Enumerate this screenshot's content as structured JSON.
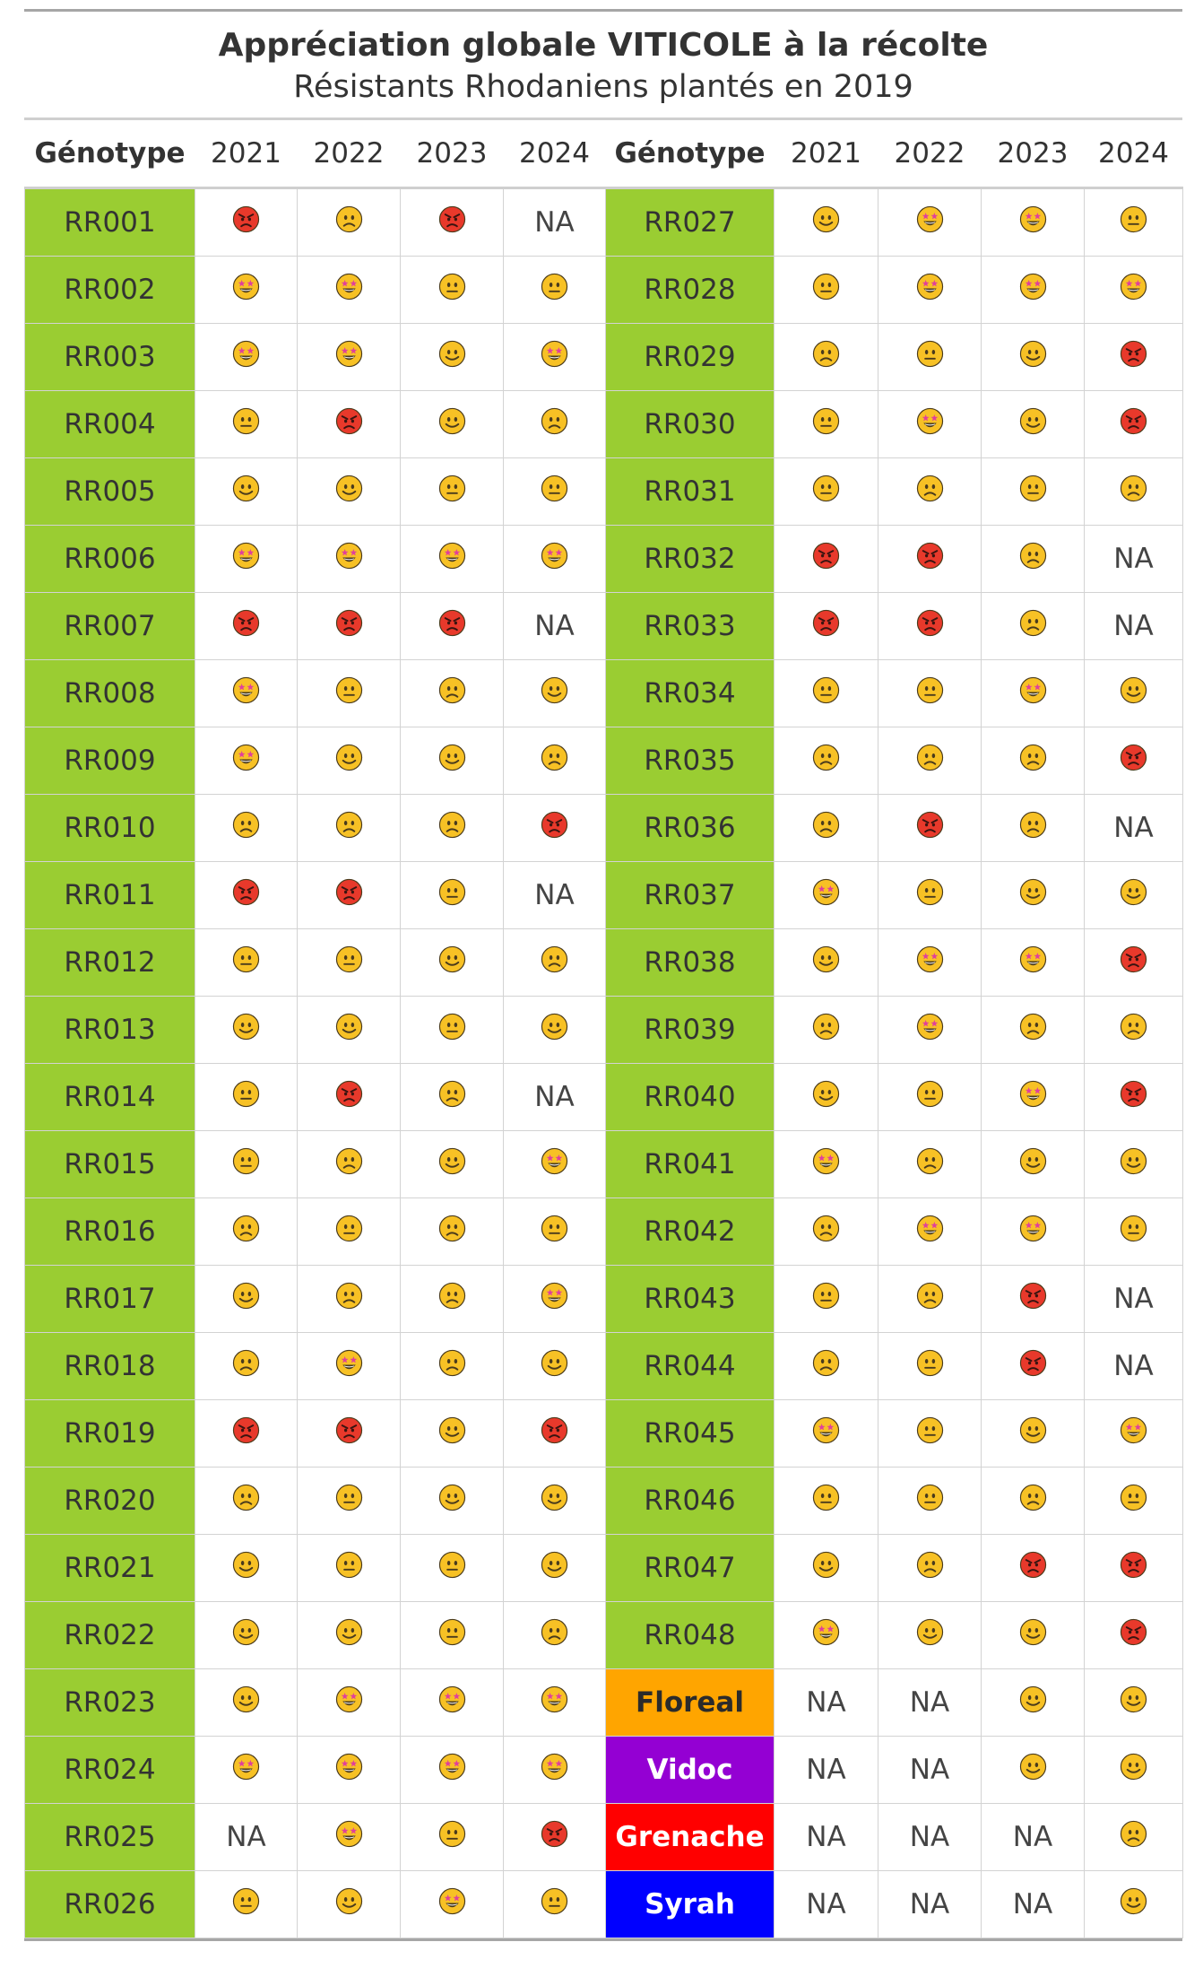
{
  "title": "Appréciation globale VITICOLE à la récolte",
  "subtitle": "Résistants Rhodaniens plantés en 2019",
  "headers": [
    "Génotype",
    "2021",
    "2022",
    "2023",
    "2024"
  ],
  "na_text": "NA",
  "colors": {
    "rr": "#9acd32",
    "Floreal": "#ffa500",
    "Vidoc": "#9400d3",
    "Grenache": "#ff0000",
    "Syrah": "#0000ff",
    "emoji_yellow": "#f7c125",
    "emoji_red": "#e8392b",
    "emoji_stars": "#e0409b"
  },
  "scale": {
    "angry": "very bad",
    "frown": "bad",
    "neutral": "average",
    "smile": "good",
    "stars": "very good"
  },
  "rows": [
    {
      "name": "RR001",
      "v": [
        "angry",
        "frown",
        "angry",
        "NA"
      ]
    },
    {
      "name": "RR002",
      "v": [
        "stars",
        "stars",
        "neutral",
        "neutral"
      ]
    },
    {
      "name": "RR003",
      "v": [
        "stars",
        "stars",
        "smile",
        "stars"
      ]
    },
    {
      "name": "RR004",
      "v": [
        "neutral",
        "angry",
        "smile",
        "frown"
      ]
    },
    {
      "name": "RR005",
      "v": [
        "smile",
        "smile",
        "neutral",
        "neutral"
      ]
    },
    {
      "name": "RR006",
      "v": [
        "stars",
        "stars",
        "stars",
        "stars"
      ]
    },
    {
      "name": "RR007",
      "v": [
        "angry",
        "angry",
        "angry",
        "NA"
      ]
    },
    {
      "name": "RR008",
      "v": [
        "stars",
        "neutral",
        "frown",
        "smile"
      ]
    },
    {
      "name": "RR009",
      "v": [
        "stars",
        "smile",
        "smile",
        "frown"
      ]
    },
    {
      "name": "RR010",
      "v": [
        "frown",
        "frown",
        "frown",
        "angry"
      ]
    },
    {
      "name": "RR011",
      "v": [
        "angry",
        "angry",
        "neutral",
        "NA"
      ]
    },
    {
      "name": "RR012",
      "v": [
        "neutral",
        "neutral",
        "smile",
        "frown"
      ]
    },
    {
      "name": "RR013",
      "v": [
        "smile",
        "smile",
        "neutral",
        "smile"
      ]
    },
    {
      "name": "RR014",
      "v": [
        "neutral",
        "angry",
        "frown",
        "NA"
      ]
    },
    {
      "name": "RR015",
      "v": [
        "neutral",
        "frown",
        "smile",
        "stars"
      ]
    },
    {
      "name": "RR016",
      "v": [
        "frown",
        "neutral",
        "frown",
        "neutral"
      ]
    },
    {
      "name": "RR017",
      "v": [
        "smile",
        "frown",
        "frown",
        "stars"
      ]
    },
    {
      "name": "RR018",
      "v": [
        "frown",
        "stars",
        "frown",
        "smile"
      ]
    },
    {
      "name": "RR019",
      "v": [
        "angry",
        "angry",
        "smile",
        "angry"
      ]
    },
    {
      "name": "RR020",
      "v": [
        "frown",
        "neutral",
        "smile",
        "smile"
      ]
    },
    {
      "name": "RR021",
      "v": [
        "smile",
        "neutral",
        "neutral",
        "smile"
      ]
    },
    {
      "name": "RR022",
      "v": [
        "smile",
        "smile",
        "neutral",
        "frown"
      ]
    },
    {
      "name": "RR023",
      "v": [
        "smile",
        "stars",
        "stars",
        "stars"
      ]
    },
    {
      "name": "RR024",
      "v": [
        "stars",
        "stars",
        "stars",
        "stars"
      ]
    },
    {
      "name": "RR025",
      "v": [
        "NA",
        "stars",
        "neutral",
        "angry"
      ]
    },
    {
      "name": "RR026",
      "v": [
        "neutral",
        "smile",
        "stars",
        "neutral"
      ]
    },
    {
      "name": "RR027",
      "v": [
        "smile",
        "stars",
        "stars",
        "neutral"
      ]
    },
    {
      "name": "RR028",
      "v": [
        "neutral",
        "stars",
        "stars",
        "stars"
      ]
    },
    {
      "name": "RR029",
      "v": [
        "frown",
        "neutral",
        "smile",
        "angry"
      ]
    },
    {
      "name": "RR030",
      "v": [
        "neutral",
        "stars",
        "smile",
        "angry"
      ]
    },
    {
      "name": "RR031",
      "v": [
        "neutral",
        "frown",
        "neutral",
        "frown"
      ]
    },
    {
      "name": "RR032",
      "v": [
        "angry",
        "angry",
        "frown",
        "NA"
      ]
    },
    {
      "name": "RR033",
      "v": [
        "angry",
        "angry",
        "frown",
        "NA"
      ]
    },
    {
      "name": "RR034",
      "v": [
        "neutral",
        "neutral",
        "stars",
        "smile"
      ]
    },
    {
      "name": "RR035",
      "v": [
        "frown",
        "frown",
        "frown",
        "angry"
      ]
    },
    {
      "name": "RR036",
      "v": [
        "frown",
        "angry",
        "frown",
        "NA"
      ]
    },
    {
      "name": "RR037",
      "v": [
        "stars",
        "neutral",
        "smile",
        "smile"
      ]
    },
    {
      "name": "RR038",
      "v": [
        "smile",
        "stars",
        "stars",
        "angry"
      ]
    },
    {
      "name": "RR039",
      "v": [
        "frown",
        "stars",
        "frown",
        "frown"
      ]
    },
    {
      "name": "RR040",
      "v": [
        "smile",
        "neutral",
        "stars",
        "angry"
      ]
    },
    {
      "name": "RR041",
      "v": [
        "stars",
        "frown",
        "smile",
        "smile"
      ]
    },
    {
      "name": "RR042",
      "v": [
        "frown",
        "stars",
        "stars",
        "neutral"
      ]
    },
    {
      "name": "RR043",
      "v": [
        "neutral",
        "frown",
        "angry",
        "NA"
      ]
    },
    {
      "name": "RR044",
      "v": [
        "frown",
        "neutral",
        "angry",
        "NA"
      ]
    },
    {
      "name": "RR045",
      "v": [
        "stars",
        "neutral",
        "smile",
        "stars"
      ]
    },
    {
      "name": "RR046",
      "v": [
        "neutral",
        "neutral",
        "frown",
        "neutral"
      ]
    },
    {
      "name": "RR047",
      "v": [
        "smile",
        "frown",
        "angry",
        "angry"
      ]
    },
    {
      "name": "RR048",
      "v": [
        "stars",
        "smile",
        "smile",
        "angry"
      ]
    },
    {
      "name": "Floreal",
      "v": [
        "NA",
        "NA",
        "smile",
        "smile"
      ]
    },
    {
      "name": "Vidoc",
      "v": [
        "NA",
        "NA",
        "smile",
        "smile"
      ]
    },
    {
      "name": "Grenache",
      "v": [
        "NA",
        "NA",
        "NA",
        "frown"
      ]
    },
    {
      "name": "Syrah",
      "v": [
        "NA",
        "NA",
        "NA",
        "smile"
      ]
    }
  ]
}
